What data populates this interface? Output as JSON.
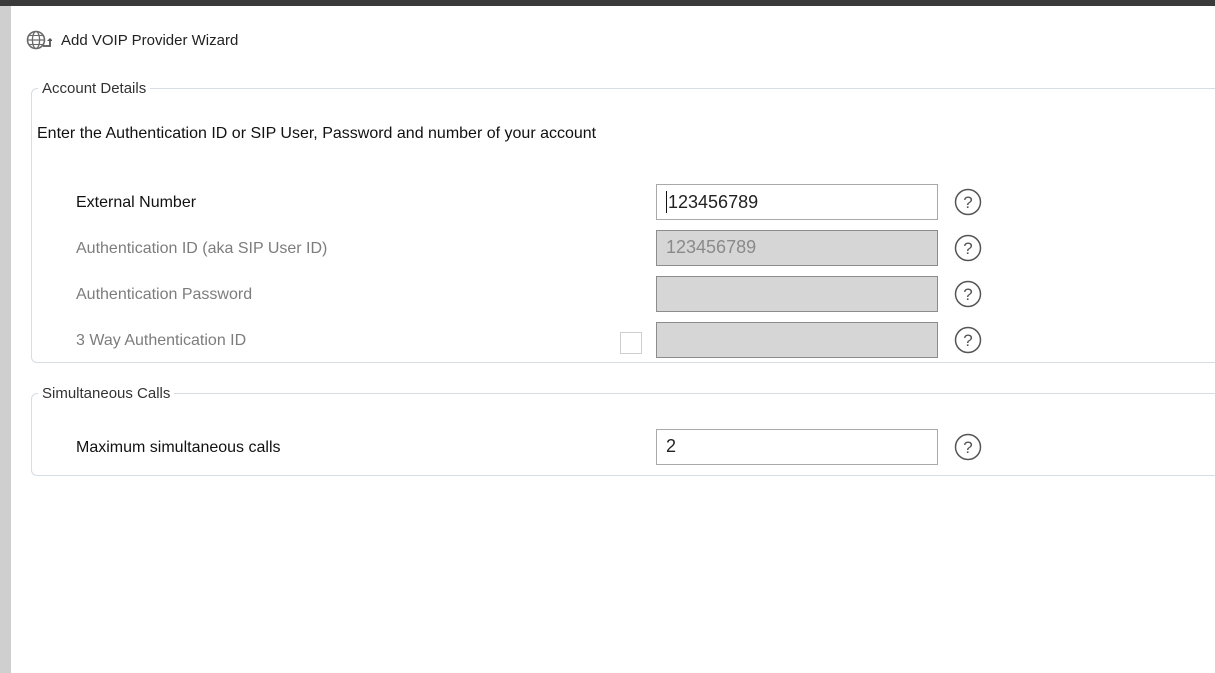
{
  "header": {
    "title": "Add VOIP Provider Wizard",
    "icon": "globe-icon"
  },
  "account_details": {
    "legend": "Account Details",
    "instruction": "Enter the Authentication ID or SIP User, Password and number of your account",
    "fields": [
      {
        "label": "External Number",
        "value": "123456789",
        "enabled": true
      },
      {
        "label": "Authentication ID (aka SIP User ID)",
        "value": "123456789",
        "enabled": false
      },
      {
        "label": "Authentication Password",
        "value": "",
        "enabled": false
      },
      {
        "label": "3 Way Authentication ID",
        "value": "",
        "enabled": false,
        "checkbox_checked": false
      }
    ]
  },
  "simultaneous_calls": {
    "legend": "Simultaneous Calls",
    "label": "Maximum simultaneous calls",
    "value": "2"
  },
  "colors": {
    "disabled_field_bg": "#d6d6d6",
    "disabled_text": "#7d7d7d",
    "fieldset_border": "#d6dde4"
  }
}
